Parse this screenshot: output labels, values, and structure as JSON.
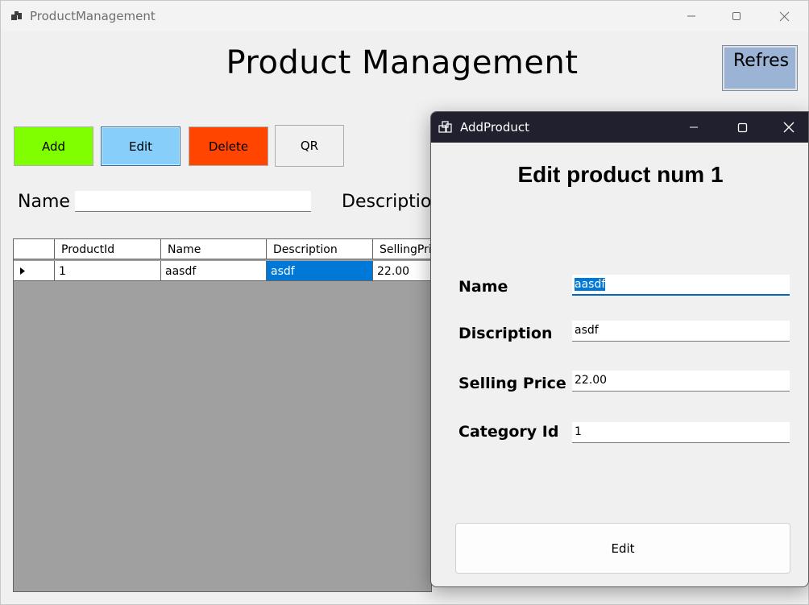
{
  "main_window": {
    "title": "ProductManagement",
    "app_icon": "window-app-icon",
    "heading": "Product Management",
    "refresh_label": "Refres",
    "toolbar": {
      "add_label": "Add",
      "edit_label": "Edit",
      "delete_label": "Delete",
      "qr_label": "QR",
      "add_color": "#7fff00",
      "edit_color": "#87cefa",
      "delete_color": "#ff4500"
    },
    "filters": {
      "name_label": "Name",
      "name_value": "",
      "description_label": "Description"
    },
    "grid": {
      "columns": [
        "ProductId",
        "Name",
        "Description",
        "SellingPri"
      ],
      "rows": [
        {
          "ProductId": "1",
          "Name": "aasdf",
          "Description": "asdf",
          "SellingPrice": "22.00"
        }
      ],
      "selection_color": "#0078d7"
    }
  },
  "dialog": {
    "title": "AddProduct",
    "heading": "Edit product num 1",
    "fields": {
      "name_label": "Name",
      "name_value": "aasdf",
      "description_label": "Discription",
      "description_value": "asdf",
      "price_label": "Selling Price",
      "price_value": "22.00",
      "category_label": "Category Id",
      "category_value": "1"
    },
    "submit_label": "Edit"
  }
}
